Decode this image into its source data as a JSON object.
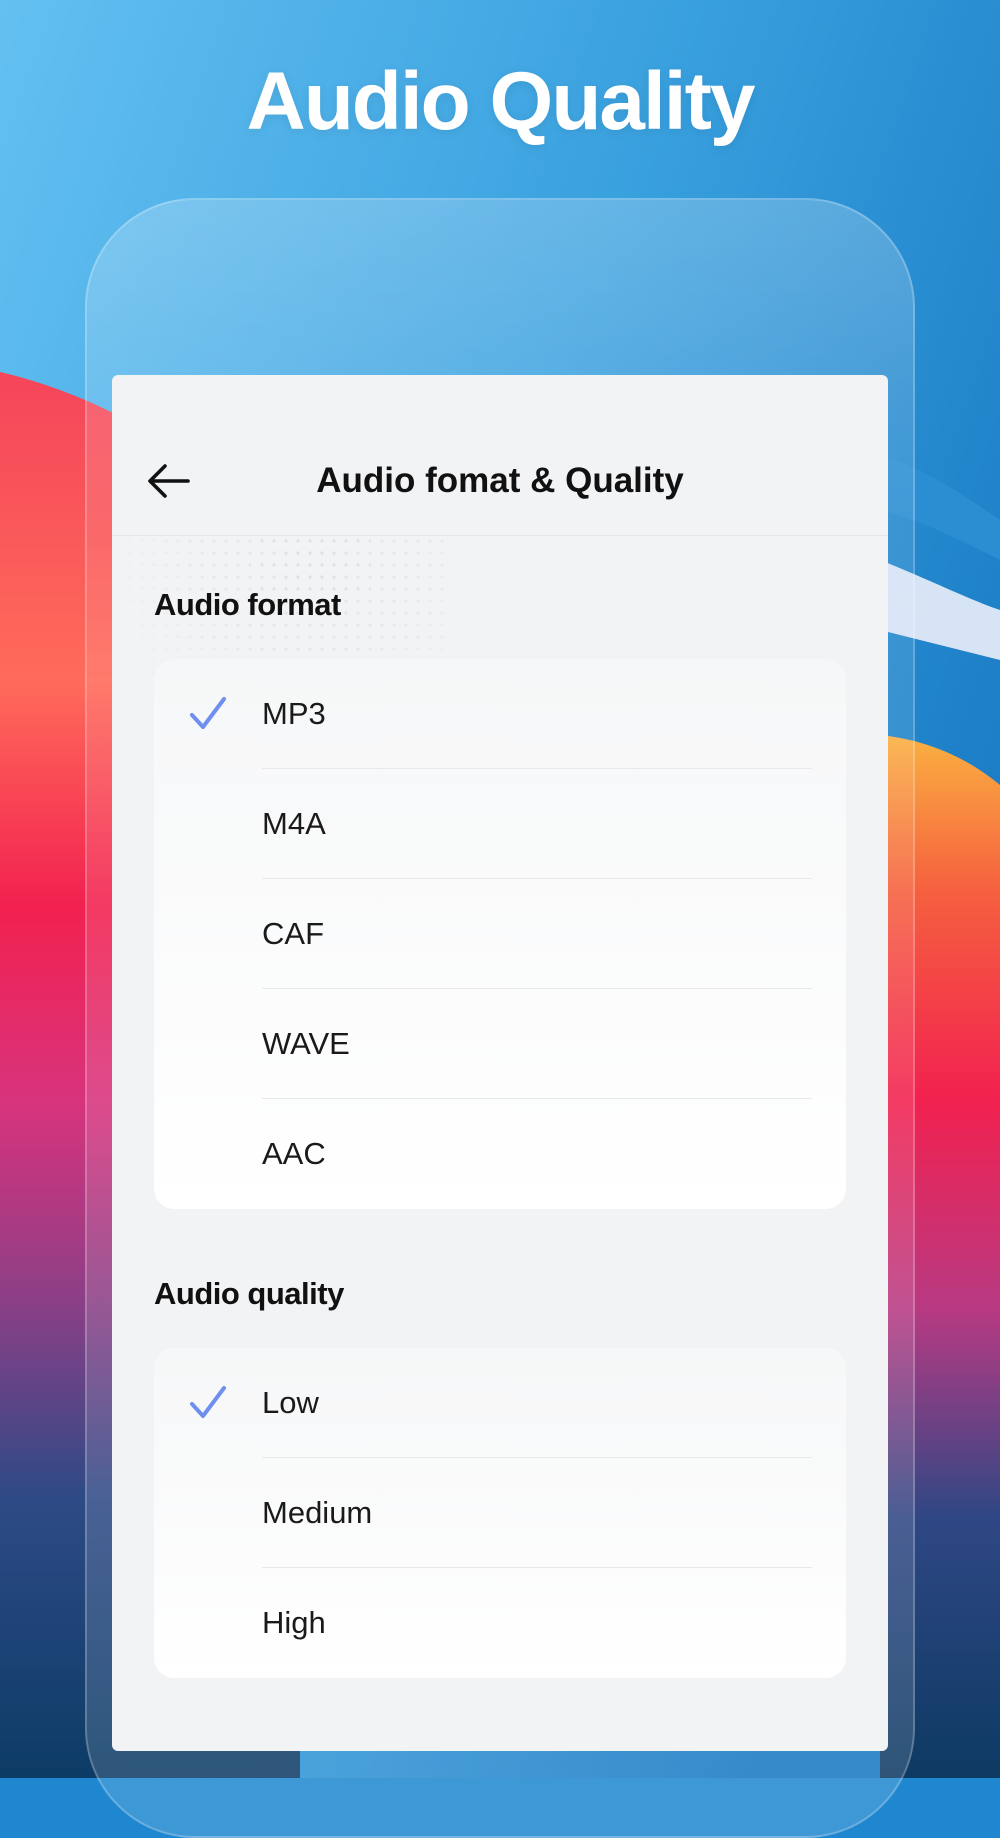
{
  "headline": "Audio Quality",
  "colors": {
    "accent_check": "#6f8ff0",
    "sky_top": "#5fbcef",
    "sky_right": "#1a80c8"
  },
  "nav": {
    "back_icon": "arrow-left-icon",
    "title": "Audio fomat & Quality"
  },
  "format_section": {
    "label": "Audio format",
    "options": [
      {
        "label": "MP3",
        "selected": true
      },
      {
        "label": "M4A",
        "selected": false
      },
      {
        "label": "CAF",
        "selected": false
      },
      {
        "label": "WAVE",
        "selected": false
      },
      {
        "label": "AAC",
        "selected": false
      }
    ]
  },
  "quality_section": {
    "label": "Audio quality",
    "options": [
      {
        "label": "Low",
        "selected": true
      },
      {
        "label": "Medium",
        "selected": false
      },
      {
        "label": "High",
        "selected": false
      }
    ]
  }
}
